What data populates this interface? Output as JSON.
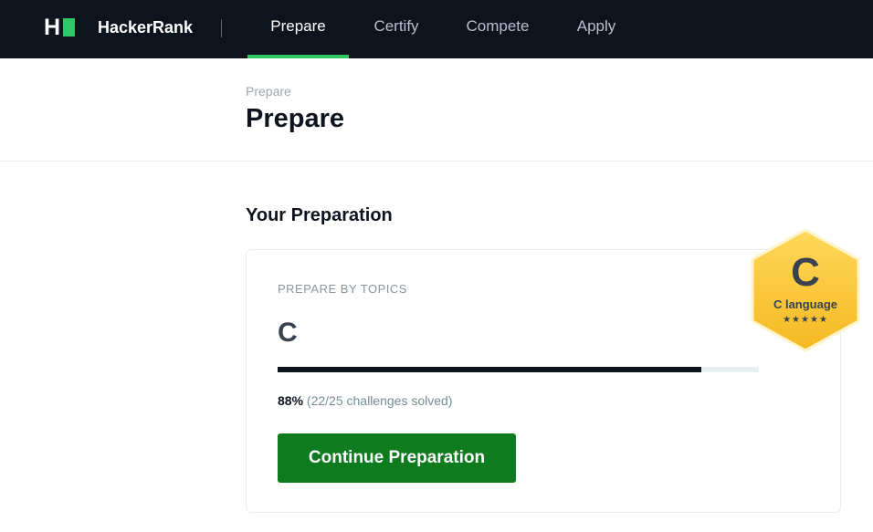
{
  "nav": {
    "brand": "HackerRank",
    "items": [
      {
        "label": "Prepare",
        "active": true
      },
      {
        "label": "Certify",
        "active": false
      },
      {
        "label": "Compete",
        "active": false
      },
      {
        "label": "Apply",
        "active": false
      }
    ]
  },
  "header": {
    "breadcrumb": "Prepare",
    "title": "Prepare"
  },
  "preparation": {
    "section_title": "Your Preparation",
    "topics_label": "PREPARE BY TOPICS",
    "topic": "C",
    "progress": {
      "percent_value": 88,
      "percent_label": "88%",
      "detail": "(22/25 challenges solved)"
    },
    "button_label": "Continue Preparation"
  },
  "badge": {
    "letter": "C",
    "label": "C language",
    "stars": "★★★★★",
    "color": "#f7c02c"
  },
  "colors": {
    "nav_bg": "#0e141e",
    "accent_green": "#2ec866",
    "button_green": "#0e7c1e"
  }
}
